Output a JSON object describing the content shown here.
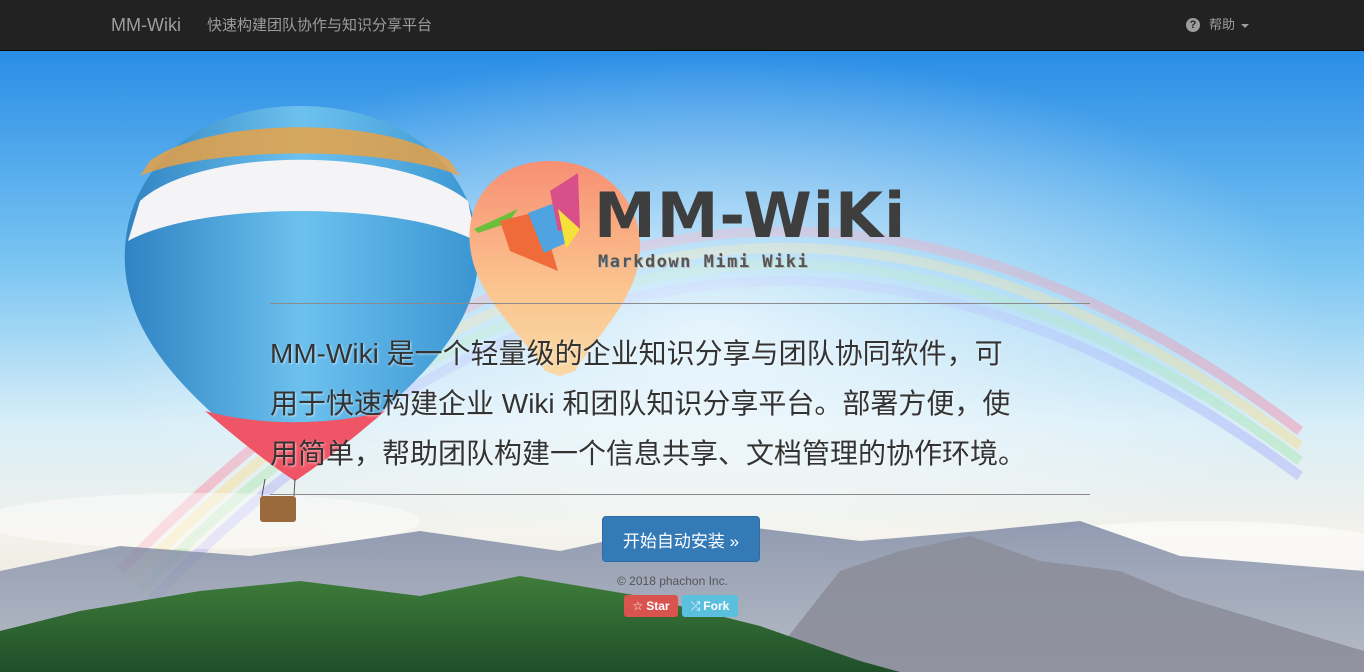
{
  "navbar": {
    "brand": "MM-Wiki",
    "subtitle": "快速构建团队协作与知识分享平台",
    "help_icon": "question-circle-icon",
    "help_label": "帮助"
  },
  "hero": {
    "logo_title": "MM-WiKi",
    "logo_subtitle": "Markdown Mimi Wiki",
    "description_lines": [
      "MM-Wiki 是一个轻量级的企业知识分享与团队协同软件，可",
      "用于快速构建企业 Wiki 和团队知识分享平台。部署方便，使",
      "用简单，帮助团队构建一个信息共享、文档管理的协作环境。"
    ],
    "install_button": "开始自动安装 »",
    "copyright": "© 2018 phachon Inc.",
    "star_icon": "star-outline-icon",
    "star_label": "Star",
    "fork_icon": "shuffle-icon",
    "fork_label": "Fork"
  },
  "colors": {
    "navbar_bg": "#222222",
    "navbar_text": "#9d9d9d",
    "primary": "#337ab7",
    "star_badge": "#d9534f",
    "fork_badge": "#5bc0de"
  }
}
